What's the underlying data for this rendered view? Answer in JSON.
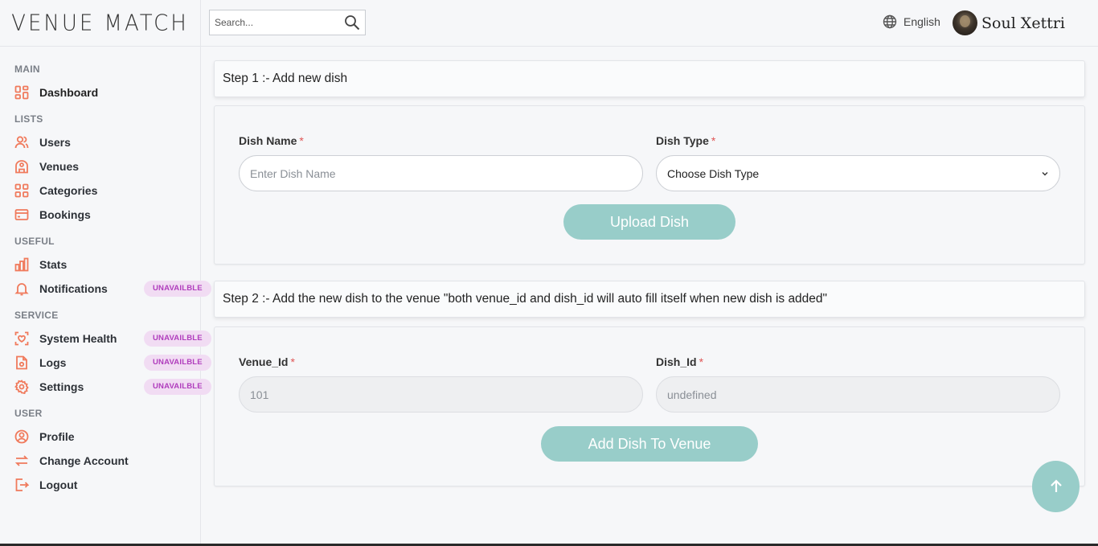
{
  "brand": {
    "logo": "VENUE MATCH"
  },
  "search": {
    "placeholder": "Search..."
  },
  "header": {
    "language": "English",
    "user_name": "Soul Xettri"
  },
  "sidebar": {
    "sections": {
      "main": "MAIN",
      "lists": "LISTS",
      "useful": "USEFUL",
      "service": "SERVICE",
      "user": "USER"
    },
    "items": {
      "dashboard": "Dashboard",
      "users": "Users",
      "venues": "Venues",
      "categories": "Categories",
      "bookings": "Bookings",
      "stats": "Stats",
      "notifications": "Notifications",
      "system_health": "System Health",
      "logs": "Logs",
      "settings": "Settings",
      "profile": "Profile",
      "change_account": "Change Account",
      "logout": "Logout"
    },
    "badge": "UNAVAILBLE"
  },
  "step1": {
    "title": "Step 1 :- Add new dish",
    "dish_name_label": "Dish Name",
    "dish_name_placeholder": "Enter Dish Name",
    "dish_type_label": "Dish Type",
    "dish_type_value": "Choose Dish Type",
    "button": "Upload Dish"
  },
  "step2": {
    "title": "Step 2 :- Add the new dish to the venue \"both venue_id and dish_id will auto fill itself when new dish is added\"",
    "venue_id_label": "Venue_Id",
    "venue_id_value": "101",
    "dish_id_label": "Dish_Id",
    "dish_id_value": "undefined",
    "button": "Add Dish To Venue"
  },
  "required_marker": "*",
  "colors": {
    "accent": "#f07a5c",
    "button": "#98cdc9",
    "badge_bg": "#f1dcf3",
    "badge_text": "#b03dbd"
  }
}
